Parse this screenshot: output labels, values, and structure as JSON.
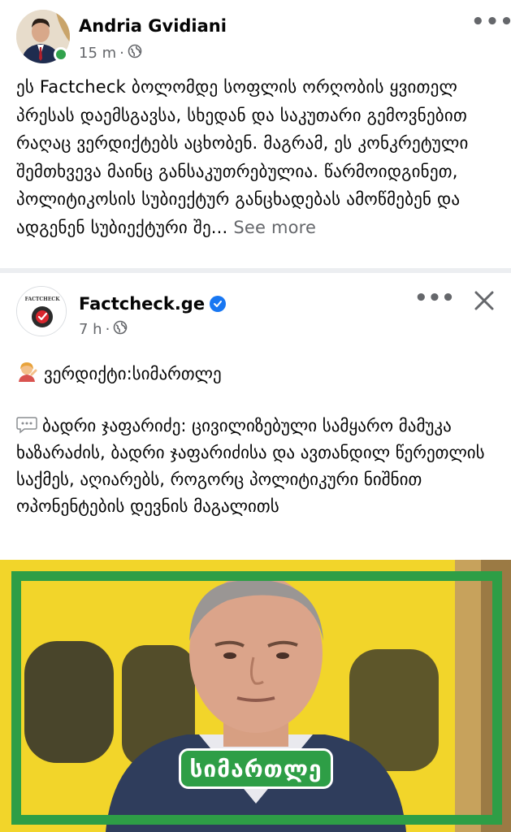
{
  "post1": {
    "author": "Andria Gvidiani",
    "time": "15 m",
    "separator": "·",
    "privacy_icon": "globe-icon",
    "more_icon": "more-options-icon",
    "text": "ეს Factcheck ბოლომდე სოფლის ორღობის ყვითელ პრესას დაემსგავსა, სხედან და საკუთარი გემოვნებით რაღაც ვერდიქტებს აცხობენ. მაგრამ, ეს კონკრეტული შემთხვევა მაინც განსაკუთრებულია. წარმოიდგინეთ, პოლიტიკოსის სუბიექტურ განცხადებას ამოწმებენ და ადგენენ სუბიექტური შე...",
    "see_more": "See more"
  },
  "post2": {
    "author": "Factcheck.ge",
    "avatar_text": "FACTCHECK",
    "time": "7 h",
    "separator": "·",
    "verified_icon": "verified-badge-icon",
    "privacy_icon": "globe-icon",
    "more_icon": "more-options-icon",
    "close_icon": "close-icon",
    "verdict": "ვერდიქტი:სიმართლე",
    "verdict_emoji_icon": "woman-tipping-hand-icon",
    "quote_icon": "speech-bubble-icon",
    "quote": "ბადრი ჯაფარიძე: ცივილიზებული სამყარო მამუკა ხაზარაძის, ბადრი ჯაფარიძისა და ავთანდილ წერეთლის საქმეს, აღიარებს, როგორც პოლიტიკური ნიშნით ოპონენტების დევნის მაგალითს",
    "image_label": "სიმართლე"
  },
  "colors": {
    "facebook_blue": "#1877f2",
    "secondary_text": "#65676b",
    "online_green": "#31a24c",
    "frame_green": "#2e9e46",
    "photo_yellow": "#f2d52a"
  }
}
